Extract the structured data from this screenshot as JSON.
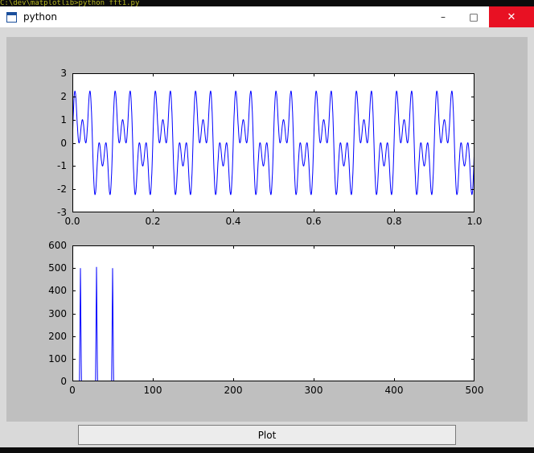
{
  "background": {
    "console_text": "C:\\dev\\matplotlib>python fft1.py"
  },
  "window": {
    "title": "python",
    "controls": [
      {
        "name": "minimize",
        "glyph": "–"
      },
      {
        "name": "maximize",
        "glyph": "□"
      },
      {
        "name": "close",
        "glyph": "✕"
      }
    ],
    "close_color": "#e81123"
  },
  "footer": {
    "plot_label": "Plot"
  },
  "chart_data": [
    {
      "name": "waveform",
      "type": "line",
      "title": "",
      "xlabel": "",
      "ylabel": "",
      "xlim": [
        0.0,
        1.0
      ],
      "ylim": [
        -3,
        3
      ],
      "xticks": {
        "values": [
          0.0,
          0.2,
          0.4,
          0.6,
          0.8,
          1.0
        ],
        "labels": [
          "0.0",
          "0.2",
          "0.4",
          "0.6",
          "0.8",
          "1.0"
        ]
      },
      "yticks": {
        "values": [
          -3,
          -2,
          -1,
          0,
          1,
          2,
          3
        ],
        "labels": [
          "-3",
          "-2",
          "-1",
          "0",
          "1",
          "2",
          "3"
        ]
      },
      "grid": false,
      "legend": null,
      "line_color": "#0000ff",
      "signal": {
        "kind": "sum_of_sines",
        "frequencies_hz": [
          10,
          30,
          50
        ],
        "amplitudes": [
          1,
          1,
          1
        ],
        "duration_s": 1.0,
        "approx_peak_value": 2.24
      }
    },
    {
      "name": "spectrum",
      "type": "line",
      "title": "",
      "xlabel": "",
      "ylabel": "",
      "xlim": [
        0,
        500
      ],
      "ylim": [
        0,
        600
      ],
      "xticks": {
        "values": [
          0,
          100,
          200,
          300,
          400,
          500
        ],
        "labels": [
          "0",
          "100",
          "200",
          "300",
          "400",
          "500"
        ]
      },
      "yticks": {
        "values": [
          0,
          100,
          200,
          300,
          400,
          500,
          600
        ],
        "labels": [
          "0",
          "100",
          "200",
          "300",
          "400",
          "500",
          "600"
        ]
      },
      "grid": false,
      "legend": null,
      "line_color": "#0000ff",
      "baseline": 0,
      "peaks": [
        {
          "freq": 10,
          "magnitude": 500
        },
        {
          "freq": 30,
          "magnitude": 505
        },
        {
          "freq": 50,
          "magnitude": 500
        }
      ]
    }
  ]
}
